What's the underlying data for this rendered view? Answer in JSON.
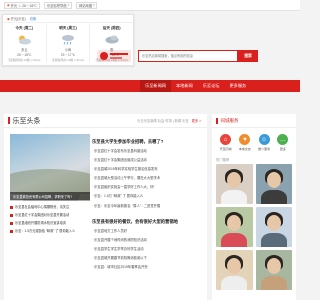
{
  "topbar": {
    "location": "开元 ☼ 26 ~ 18℃",
    "item2": "乐至贴吧导航",
    "item3": "网站地图"
  },
  "weather": {
    "location_label": "开元(乐至)",
    "switch_label": "切换",
    "days": [
      {
        "title": "今天 (周二)",
        "condition": "多云",
        "temp": "26 ~ 18℃",
        "wind": "无持续风向 ≤3级 (<4m/s)"
      },
      {
        "title": "明天 (周三)",
        "condition": "小雨",
        "temp": "23 ~ 17℃",
        "wind": "无持续风向 ≤3级 (<4m/s)"
      },
      {
        "title": "后天 (周四)",
        "condition": "阴",
        "temp": "24 ~ 16℃",
        "wind": "无持续风向 ≤3级 (<4m/s)"
      }
    ]
  },
  "search": {
    "placeholder": "乐至热点新闻搜索，搜点有用的信息",
    "button": "搜索"
  },
  "nav": {
    "items": [
      {
        "label": "乐至新闻网"
      },
      {
        "label": "本地新闻"
      },
      {
        "label": "乐至论坛"
      },
      {
        "label": "更多服务"
      }
    ]
  },
  "main": {
    "title": "乐至头条",
    "extra": "今日乐至新闻 社会 时事 | 新闻 乐至",
    "more": "更多 >",
    "feature_caption": "乐至县城投资有限公司招聘，求职来了吗?",
    "feature_list": [
      "乐至县社会福利中心捐赠物资，请关注",
      "乐至县红十字会集团对乐至县开展活动",
      "乐至县组织开展防溺水知识宣讲培训",
      "乐至：1.5万元奖励给 “邮政” 了 属你能入么"
    ],
    "headline1": "乐至县大学生参加毕业招聘，去哪了?",
    "news1": [
      "乐至县红十字会发布乐至县科普活动",
      "乐至县红十字会集团出组成公益活动",
      "乐至县城2019年科学实验学生报名信息发布",
      "乐至县城大型活动上午举行，展在大大型学术",
      "乐至县组织实验会一直学好工作人大，好!",
      "乐至：1.5万 “邮政” 了 属你能入么",
      "乐至：乐至今年最新报名: “算人” : 二进党开展"
    ],
    "headline2": "乐至县有很好的餐饮，会有很好大型的营销地",
    "news2": [
      "乐至县地方工作人员好",
      "乐至县开展个地时间的消防知识活动",
      "乐至县学生学生学举办好学生活动",
      "乐至县城开展春节前特殊消费用以下",
      "乐至县：城市社区2019年春季会开完"
    ]
  },
  "side": {
    "title": "同城服务",
    "icons": [
      {
        "label": "乐至同城"
      },
      {
        "label": "本地交友"
      },
      {
        "label": "婚介服务"
      },
      {
        "label": "更多"
      }
    ],
    "sub": "热门推荐"
  }
}
